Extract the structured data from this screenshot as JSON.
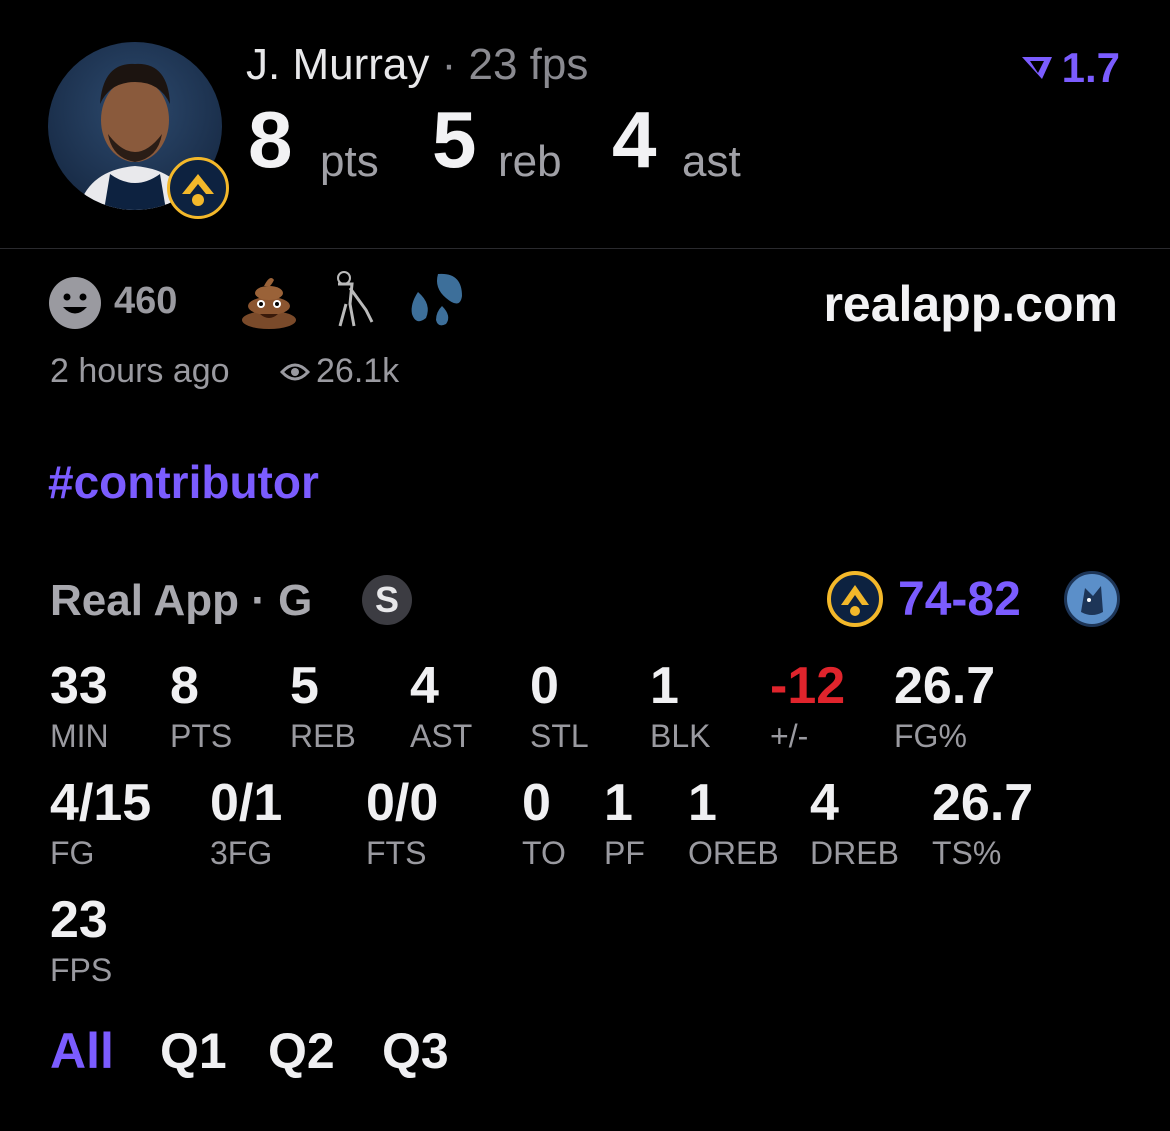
{
  "header": {
    "player_name": "J. Murray",
    "separator": "·",
    "fps_label": "23 fps",
    "pts_value": "8",
    "pts_unit": "pts",
    "reb_value": "5",
    "reb_unit": "reb",
    "ast_value": "4",
    "ast_unit": "ast",
    "boost_value": "1.7"
  },
  "reactions": {
    "count": "460",
    "time_ago": "2 hours ago",
    "views": "26.1k",
    "site": "realapp.com"
  },
  "hashtag": "#contributor",
  "game": {
    "title": "Real App · G",
    "badge": "S",
    "score": "74-82"
  },
  "stats_row1": [
    {
      "value": "33",
      "label": "MIN"
    },
    {
      "value": "8",
      "label": "PTS"
    },
    {
      "value": "5",
      "label": "REB"
    },
    {
      "value": "4",
      "label": "AST"
    },
    {
      "value": "0",
      "label": "STL"
    },
    {
      "value": "1",
      "label": "BLK"
    },
    {
      "value": "-12",
      "label": "+/-"
    },
    {
      "value": "26.7",
      "label": "FG%"
    }
  ],
  "stats_row2": [
    {
      "value": "4/15",
      "label": "FG"
    },
    {
      "value": "0/1",
      "label": "3FG"
    },
    {
      "value": "0/0",
      "label": "FTS"
    },
    {
      "value": "0",
      "label": "TO"
    },
    {
      "value": "1",
      "label": "PF"
    },
    {
      "value": "1",
      "label": "OREB"
    },
    {
      "value": "4",
      "label": "DREB"
    },
    {
      "value": "26.7",
      "label": "TS%"
    }
  ],
  "stats_row3": [
    {
      "value": "23",
      "label": "FPS"
    }
  ],
  "tabs": [
    "All",
    "Q1",
    "Q2",
    "Q3"
  ],
  "colors": {
    "accent": "#7b5cff",
    "negative": "#e0242c",
    "background": "#000000"
  }
}
